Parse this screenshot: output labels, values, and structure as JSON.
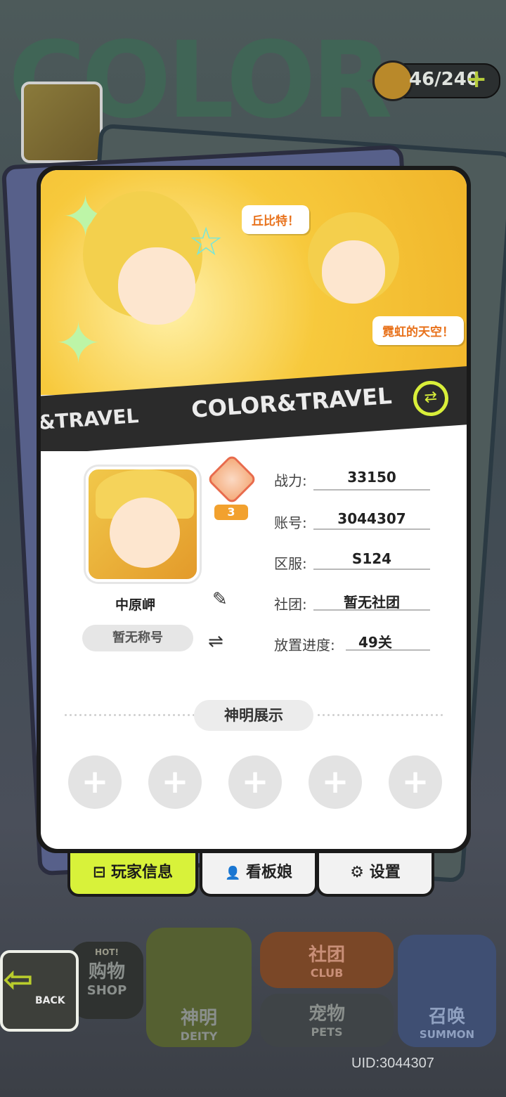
{
  "top_bar": {
    "stamina": "46/240",
    "plus": "+"
  },
  "background": {
    "word": "COLOR"
  },
  "banner": {
    "bubble_1": "丘比特！",
    "bubble_2": "霓虹的天空！",
    "stripe_text_small": "&TRAVEL",
    "stripe_text_large": "COLOR&TRAVEL",
    "stripe_icon": "⇄"
  },
  "profile": {
    "name": "中原岬",
    "title": "暂无称号",
    "rank_level": "3",
    "stats": [
      {
        "label": "战力:",
        "value": "33150"
      },
      {
        "label": "账号:",
        "value": "3044307"
      },
      {
        "label": "区服:",
        "value": "S124"
      },
      {
        "label": "社团:",
        "value": "暂无社团"
      },
      {
        "label": "放置进度:",
        "value": "49关"
      }
    ]
  },
  "deity_section": {
    "title": "神明展示",
    "slot_symbol": "+"
  },
  "tabs": [
    {
      "label": "玩家信息",
      "icon": "⊟"
    },
    {
      "label": "看板娘",
      "icon": "👤"
    },
    {
      "label": "设置",
      "icon": "⚙"
    }
  ],
  "bottom_menu": {
    "back": "BACK",
    "shop_cn": "购物",
    "shop_en": "SHOP",
    "hot": "HOT!",
    "deity_cn": "神明",
    "deity_en": "DEITY",
    "club_cn": "社团",
    "club_en": "CLUB",
    "pets_cn": "宠物",
    "pets_en": "PETS",
    "summon_cn": "召唤",
    "summon_en": "SUMMON"
  },
  "uid": "UID:3044307",
  "colors": {
    "accent": "#d8f23a",
    "banner_yellow": "#f7c93c",
    "rank_orange": "#f2a12e"
  }
}
